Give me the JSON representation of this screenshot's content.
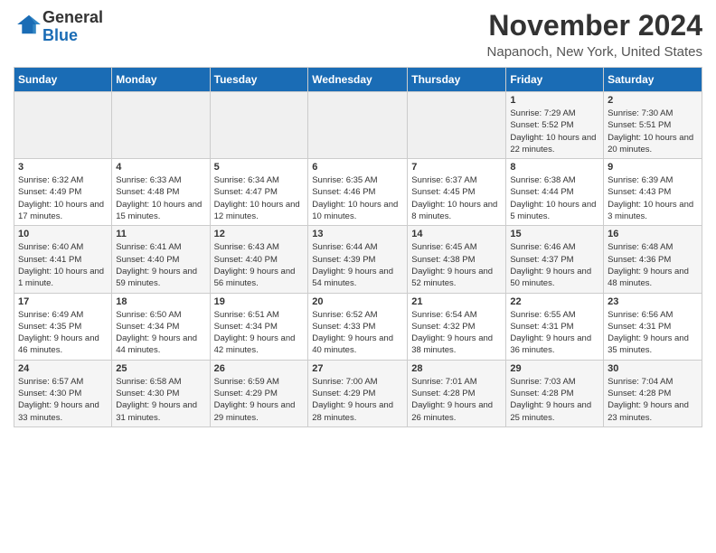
{
  "header": {
    "logo_line1": "General",
    "logo_line2": "Blue",
    "month": "November 2024",
    "location": "Napanoch, New York, United States"
  },
  "days_of_week": [
    "Sunday",
    "Monday",
    "Tuesday",
    "Wednesday",
    "Thursday",
    "Friday",
    "Saturday"
  ],
  "weeks": [
    [
      {
        "day": "",
        "info": ""
      },
      {
        "day": "",
        "info": ""
      },
      {
        "day": "",
        "info": ""
      },
      {
        "day": "",
        "info": ""
      },
      {
        "day": "",
        "info": ""
      },
      {
        "day": "1",
        "info": "Sunrise: 7:29 AM\nSunset: 5:52 PM\nDaylight: 10 hours and 22 minutes."
      },
      {
        "day": "2",
        "info": "Sunrise: 7:30 AM\nSunset: 5:51 PM\nDaylight: 10 hours and 20 minutes."
      }
    ],
    [
      {
        "day": "3",
        "info": "Sunrise: 6:32 AM\nSunset: 4:49 PM\nDaylight: 10 hours and 17 minutes."
      },
      {
        "day": "4",
        "info": "Sunrise: 6:33 AM\nSunset: 4:48 PM\nDaylight: 10 hours and 15 minutes."
      },
      {
        "day": "5",
        "info": "Sunrise: 6:34 AM\nSunset: 4:47 PM\nDaylight: 10 hours and 12 minutes."
      },
      {
        "day": "6",
        "info": "Sunrise: 6:35 AM\nSunset: 4:46 PM\nDaylight: 10 hours and 10 minutes."
      },
      {
        "day": "7",
        "info": "Sunrise: 6:37 AM\nSunset: 4:45 PM\nDaylight: 10 hours and 8 minutes."
      },
      {
        "day": "8",
        "info": "Sunrise: 6:38 AM\nSunset: 4:44 PM\nDaylight: 10 hours and 5 minutes."
      },
      {
        "day": "9",
        "info": "Sunrise: 6:39 AM\nSunset: 4:43 PM\nDaylight: 10 hours and 3 minutes."
      }
    ],
    [
      {
        "day": "10",
        "info": "Sunrise: 6:40 AM\nSunset: 4:41 PM\nDaylight: 10 hours and 1 minute."
      },
      {
        "day": "11",
        "info": "Sunrise: 6:41 AM\nSunset: 4:40 PM\nDaylight: 9 hours and 59 minutes."
      },
      {
        "day": "12",
        "info": "Sunrise: 6:43 AM\nSunset: 4:40 PM\nDaylight: 9 hours and 56 minutes."
      },
      {
        "day": "13",
        "info": "Sunrise: 6:44 AM\nSunset: 4:39 PM\nDaylight: 9 hours and 54 minutes."
      },
      {
        "day": "14",
        "info": "Sunrise: 6:45 AM\nSunset: 4:38 PM\nDaylight: 9 hours and 52 minutes."
      },
      {
        "day": "15",
        "info": "Sunrise: 6:46 AM\nSunset: 4:37 PM\nDaylight: 9 hours and 50 minutes."
      },
      {
        "day": "16",
        "info": "Sunrise: 6:48 AM\nSunset: 4:36 PM\nDaylight: 9 hours and 48 minutes."
      }
    ],
    [
      {
        "day": "17",
        "info": "Sunrise: 6:49 AM\nSunset: 4:35 PM\nDaylight: 9 hours and 46 minutes."
      },
      {
        "day": "18",
        "info": "Sunrise: 6:50 AM\nSunset: 4:34 PM\nDaylight: 9 hours and 44 minutes."
      },
      {
        "day": "19",
        "info": "Sunrise: 6:51 AM\nSunset: 4:34 PM\nDaylight: 9 hours and 42 minutes."
      },
      {
        "day": "20",
        "info": "Sunrise: 6:52 AM\nSunset: 4:33 PM\nDaylight: 9 hours and 40 minutes."
      },
      {
        "day": "21",
        "info": "Sunrise: 6:54 AM\nSunset: 4:32 PM\nDaylight: 9 hours and 38 minutes."
      },
      {
        "day": "22",
        "info": "Sunrise: 6:55 AM\nSunset: 4:31 PM\nDaylight: 9 hours and 36 minutes."
      },
      {
        "day": "23",
        "info": "Sunrise: 6:56 AM\nSunset: 4:31 PM\nDaylight: 9 hours and 35 minutes."
      }
    ],
    [
      {
        "day": "24",
        "info": "Sunrise: 6:57 AM\nSunset: 4:30 PM\nDaylight: 9 hours and 33 minutes."
      },
      {
        "day": "25",
        "info": "Sunrise: 6:58 AM\nSunset: 4:30 PM\nDaylight: 9 hours and 31 minutes."
      },
      {
        "day": "26",
        "info": "Sunrise: 6:59 AM\nSunset: 4:29 PM\nDaylight: 9 hours and 29 minutes."
      },
      {
        "day": "27",
        "info": "Sunrise: 7:00 AM\nSunset: 4:29 PM\nDaylight: 9 hours and 28 minutes."
      },
      {
        "day": "28",
        "info": "Sunrise: 7:01 AM\nSunset: 4:28 PM\nDaylight: 9 hours and 26 minutes."
      },
      {
        "day": "29",
        "info": "Sunrise: 7:03 AM\nSunset: 4:28 PM\nDaylight: 9 hours and 25 minutes."
      },
      {
        "day": "30",
        "info": "Sunrise: 7:04 AM\nSunset: 4:28 PM\nDaylight: 9 hours and 23 minutes."
      }
    ]
  ]
}
